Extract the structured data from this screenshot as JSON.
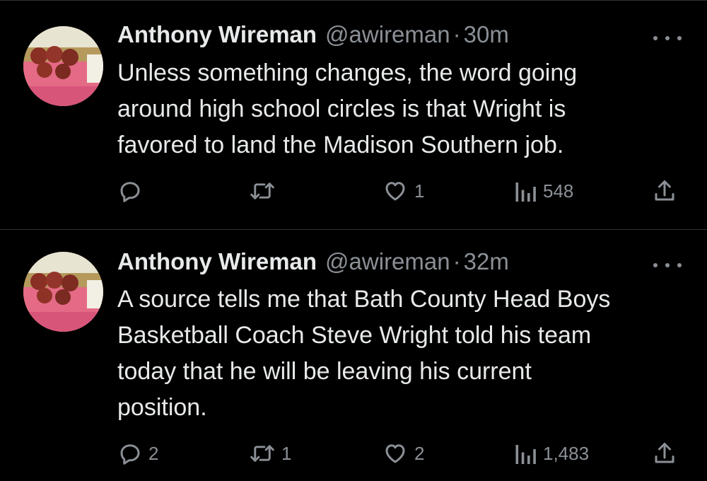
{
  "tweets": [
    {
      "author": {
        "name": "Anthony Wireman",
        "handle": "@awireman",
        "separator": "·",
        "time": "30m"
      },
      "text_lines": [
        "Unless something changes, the word going",
        "around high school circles is that Wright is",
        "favored to land the Madison Southern job."
      ],
      "actions": {
        "reply": "",
        "retweet": "",
        "like": "1",
        "views": "548"
      }
    },
    {
      "author": {
        "name": "Anthony Wireman",
        "handle": "@awireman",
        "separator": "·",
        "time": "32m"
      },
      "text_lines": [
        "A source tells me that Bath County Head Boys",
        "Basketball Coach Steve Wright told his team",
        "today that he will be leaving his current",
        "position."
      ],
      "actions": {
        "reply": "2",
        "retweet": "1",
        "like": "2",
        "views": "1,483"
      }
    }
  ],
  "icons": {
    "reply": "speech-bubble-icon",
    "retweet": "retweet-arrows-icon",
    "like": "heart-icon",
    "views": "bar-chart-icon",
    "share": "share-upload-icon",
    "more": "ellipsis-icon"
  },
  "colors": {
    "background": "#000000",
    "text_primary": "#e7e9ea",
    "text_secondary": "#8b9096",
    "divider": "#2f3336"
  }
}
